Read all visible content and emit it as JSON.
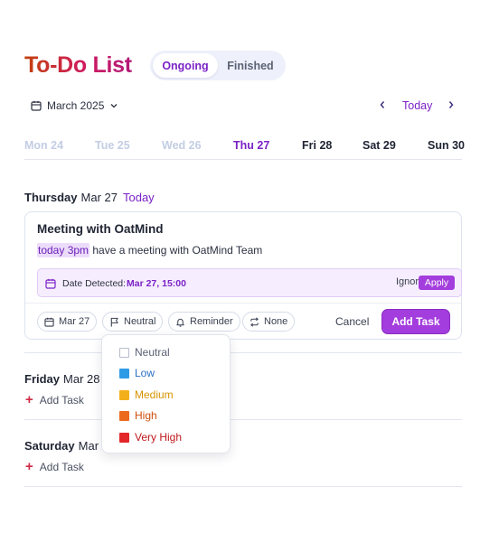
{
  "header": {
    "title": "To-Do List",
    "tabs": [
      {
        "label": "Ongoing",
        "active": true
      },
      {
        "label": "Finished",
        "active": false
      }
    ]
  },
  "calendar": {
    "month_label": "March 2025",
    "today_label": "Today",
    "days": [
      {
        "label": "Mon 24",
        "state": "past"
      },
      {
        "label": "Tue 25",
        "state": "past"
      },
      {
        "label": "Wed 26",
        "state": "past"
      },
      {
        "label": "Thu 27",
        "state": "today"
      },
      {
        "label": "Fri 28",
        "state": "future"
      },
      {
        "label": "Sat 29",
        "state": "future"
      },
      {
        "label": "Sun 30",
        "state": "future"
      }
    ]
  },
  "sections": {
    "thursday": {
      "day": "Thursday",
      "date": "Mar 27",
      "tag": "Today"
    },
    "friday": {
      "day": "Friday",
      "date": "Mar 28",
      "add_label": "Add Task"
    },
    "saturday": {
      "day": "Saturday",
      "date": "Mar",
      "add_label": "Add Task"
    }
  },
  "task_card": {
    "title": "Meeting with OatMind",
    "description_highlight": "today 3pm",
    "description_rest": " have a meeting with OatMind Team",
    "detection": {
      "label": "Date Detected:",
      "value": "Mar 27, 15:00",
      "ignore_label": "Ignore",
      "apply_label": "Apply"
    },
    "chips": {
      "date": "Mar 27",
      "priority": "Neutral",
      "reminder": "Reminder",
      "repeat": "None"
    },
    "cancel_label": "Cancel",
    "add_label": "Add Task"
  },
  "priority_menu": {
    "options": [
      {
        "label": "Neutral",
        "color": "#ffffff",
        "text_color": "#5b6275"
      },
      {
        "label": "Low",
        "color": "#2e9be6",
        "text_color": "#2b6fc0"
      },
      {
        "label": "Medium",
        "color": "#f4b01c",
        "text_color": "#d69400"
      },
      {
        "label": "High",
        "color": "#ec6a1d",
        "text_color": "#cf4f0c"
      },
      {
        "label": "Very High",
        "color": "#e3262a",
        "text_color": "#c0181d"
      }
    ]
  },
  "colors": {
    "accent": "#7b22c7",
    "button": "#a33ddd",
    "highlight_bg": "#ecdcfb"
  }
}
